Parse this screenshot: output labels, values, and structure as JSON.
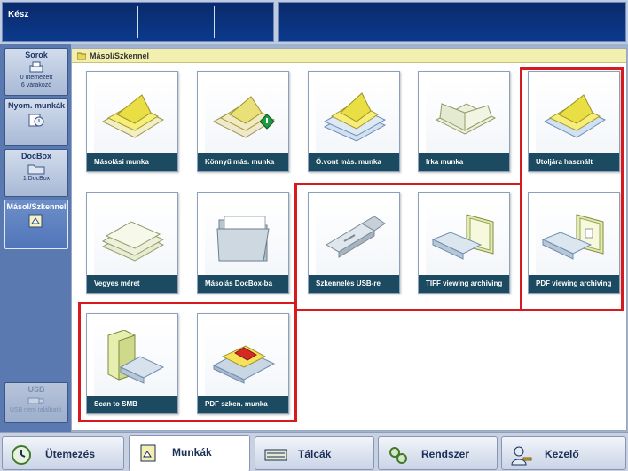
{
  "status": {
    "text": "Kész"
  },
  "sidebar": {
    "items": [
      {
        "title": "Sorok",
        "sub1": "0 ütemezett",
        "sub2": "6 várakozó"
      },
      {
        "title": "Nyom. munkák"
      },
      {
        "title": "DocBox",
        "sub1": "1 DocBox"
      },
      {
        "title": "Másol/Szkennel"
      },
      {
        "title": "USB",
        "sub1": "USB nem található."
      }
    ]
  },
  "content": {
    "title": "Másol/Szkennel",
    "tiles": [
      {
        "label": "Másolási munka"
      },
      {
        "label": "Könnyű más. munka"
      },
      {
        "label": "Ö.vont más. munka"
      },
      {
        "label": "Irka munka"
      },
      {
        "label": "Utoljára használt"
      },
      {
        "label": "Vegyes méret"
      },
      {
        "label": "Másolás DocBox-ba"
      },
      {
        "label": "Szkennelés USB-re"
      },
      {
        "label": "TIFF viewing archiving"
      },
      {
        "label": "PDF viewing archiving"
      },
      {
        "label": "Scan to SMB"
      },
      {
        "label": "PDF szken. munka"
      }
    ]
  },
  "tabs": [
    {
      "label": "Ütemezés"
    },
    {
      "label": "Munkák"
    },
    {
      "label": "Tálcák"
    },
    {
      "label": "Rendszer"
    },
    {
      "label": "Kezelő"
    }
  ]
}
